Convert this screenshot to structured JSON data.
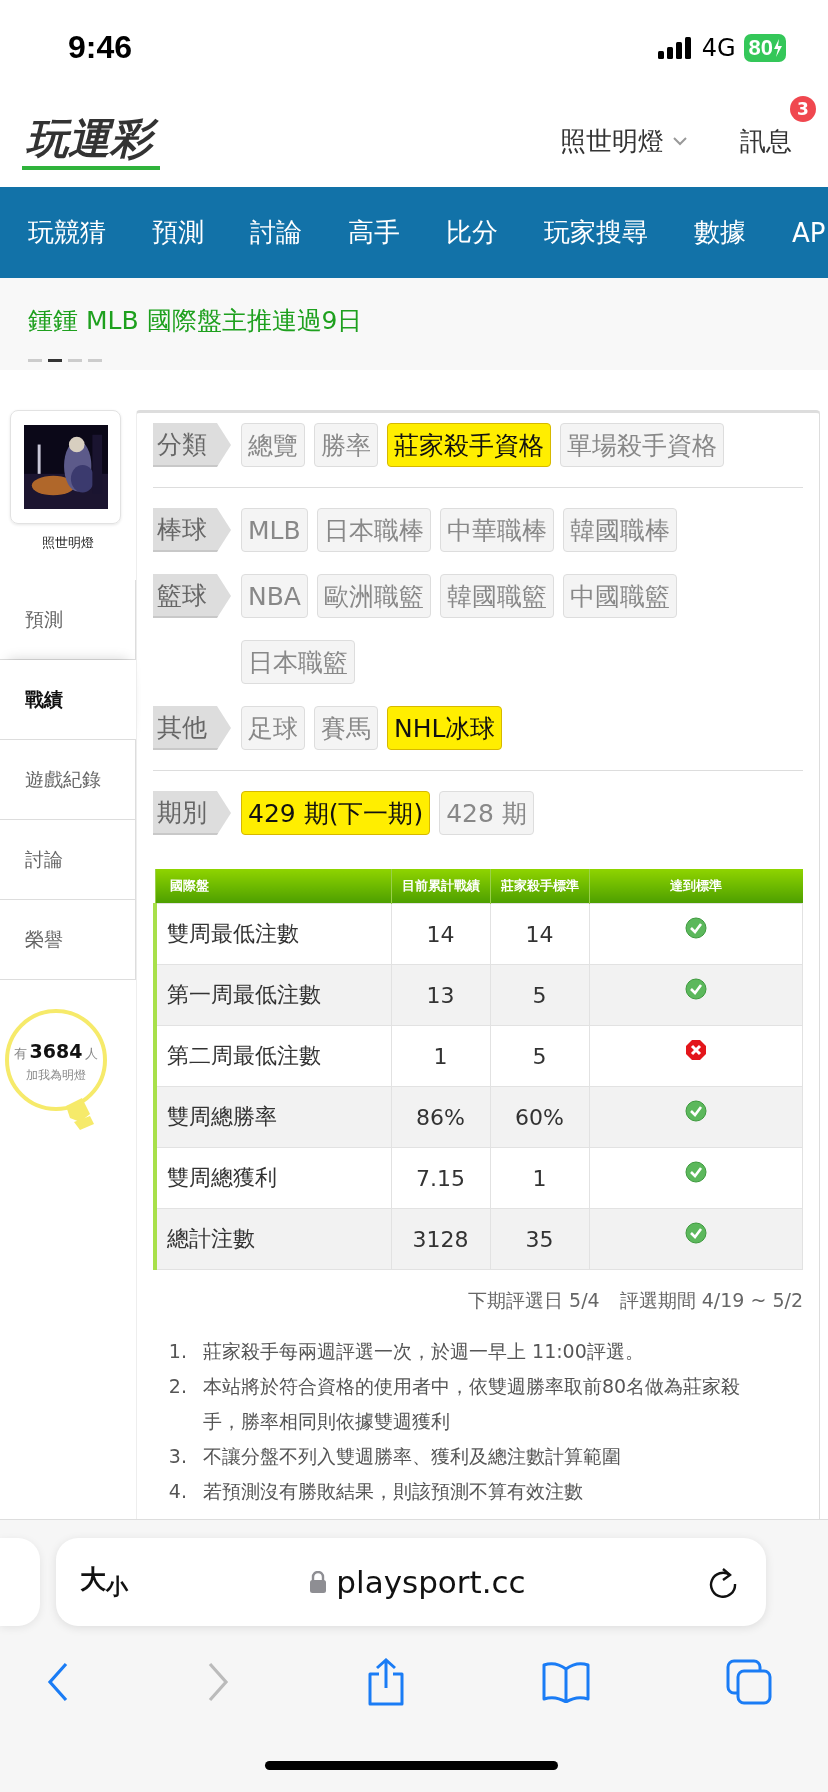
{
  "status_bar": {
    "time": "9:46",
    "network": "4G",
    "battery": "80"
  },
  "header": {
    "logo": "玩運彩",
    "user": "照世明燈",
    "messages": {
      "label": "訊息",
      "badge": "3"
    }
  },
  "nav": [
    {
      "label": "玩競猜"
    },
    {
      "label": "預測"
    },
    {
      "label": "討論"
    },
    {
      "label": "高手"
    },
    {
      "label": "比分"
    },
    {
      "label": "玩家搜尋"
    },
    {
      "label": "數據"
    },
    {
      "label": "AP"
    }
  ],
  "promo": {
    "text": "鍾鍾 MLB 國際盤主推連過9日",
    "pages": [
      {
        "selected": false
      },
      {
        "selected": true
      },
      {
        "selected": false
      },
      {
        "selected": false
      }
    ]
  },
  "sidebar": {
    "name": "照世明燈",
    "items": [
      {
        "label": "預測",
        "selected": false
      },
      {
        "label": "戰績",
        "selected": true
      },
      {
        "label": "遊戲紀錄",
        "selected": false
      },
      {
        "label": "討論",
        "selected": false
      },
      {
        "label": "榮譽",
        "selected": false
      }
    ],
    "fans": {
      "prefix": "有",
      "count": "3684",
      "suffix": "人",
      "caption": "加我為明燈"
    }
  },
  "filter_sections": [
    [
      {
        "label": "分類",
        "options": [
          {
            "label": "總覽",
            "selected": false
          },
          {
            "label": "勝率",
            "selected": false
          },
          {
            "label": "莊家殺手資格",
            "selected": true
          },
          {
            "label": "單場殺手資格",
            "selected": false
          }
        ]
      }
    ],
    [
      {
        "label": "棒球",
        "options": [
          {
            "label": "MLB",
            "selected": false
          },
          {
            "label": "日本職棒",
            "selected": false
          },
          {
            "label": "中華職棒",
            "selected": false
          },
          {
            "label": "韓國職棒",
            "selected": false
          }
        ]
      },
      {
        "label": "籃球",
        "options": [
          {
            "label": "NBA",
            "selected": false
          },
          {
            "label": "歐洲職籃",
            "selected": false
          },
          {
            "label": "韓國職籃",
            "selected": false
          },
          {
            "label": "中國職籃",
            "selected": false
          },
          {
            "label": "日本職籃",
            "selected": false
          }
        ]
      },
      {
        "label": "其他",
        "options": [
          {
            "label": "足球",
            "selected": false
          },
          {
            "label": "賽馬",
            "selected": false
          },
          {
            "label": "NHL冰球",
            "selected": true
          }
        ]
      }
    ],
    [
      {
        "label": "期別",
        "options": [
          {
            "label": "429 期(下一期)",
            "selected": true
          },
          {
            "label": "428 期",
            "selected": false
          }
        ]
      }
    ]
  ],
  "table": {
    "columns": [
      "國際盤",
      "目前累計戰績",
      "莊家殺手標準",
      "達到標準"
    ],
    "rows": [
      {
        "cells": [
          "雙周最低注數",
          "14",
          "14"
        ],
        "met": true
      },
      {
        "cells": [
          "第一周最低注數",
          "13",
          "5"
        ],
        "met": true
      },
      {
        "cells": [
          "第二周最低注數",
          "1",
          "5"
        ],
        "met": false
      },
      {
        "cells": [
          "雙周總勝率",
          "86%",
          "60%"
        ],
        "met": true
      },
      {
        "cells": [
          "雙周總獲利",
          "7.15",
          "1"
        ],
        "met": true
      },
      {
        "cells": [
          "總計注數",
          "3128",
          "35"
        ],
        "met": true
      }
    ]
  },
  "schedule": [
    "下期評選日 5/4",
    "評選期間 4/19 ~ 5/2"
  ],
  "notes": [
    {
      "number": "1.",
      "text": "莊家殺手每兩週評選一次，於週一早上 11:00評選。"
    },
    {
      "number": "2.",
      "text": "本站將於符合資格的使用者中，依雙週勝率取前80名做為莊家殺手，勝率相同則依據雙週獲利"
    },
    {
      "number": "3.",
      "text": "不讓分盤不列入雙週勝率、獲利及總注數計算範圍"
    },
    {
      "number": "4.",
      "text": "若預測沒有勝敗結果，則該預測不算有效注數"
    }
  ],
  "browser": {
    "text_size": "大$_{小}$",
    "url": "playsport.cc"
  }
}
